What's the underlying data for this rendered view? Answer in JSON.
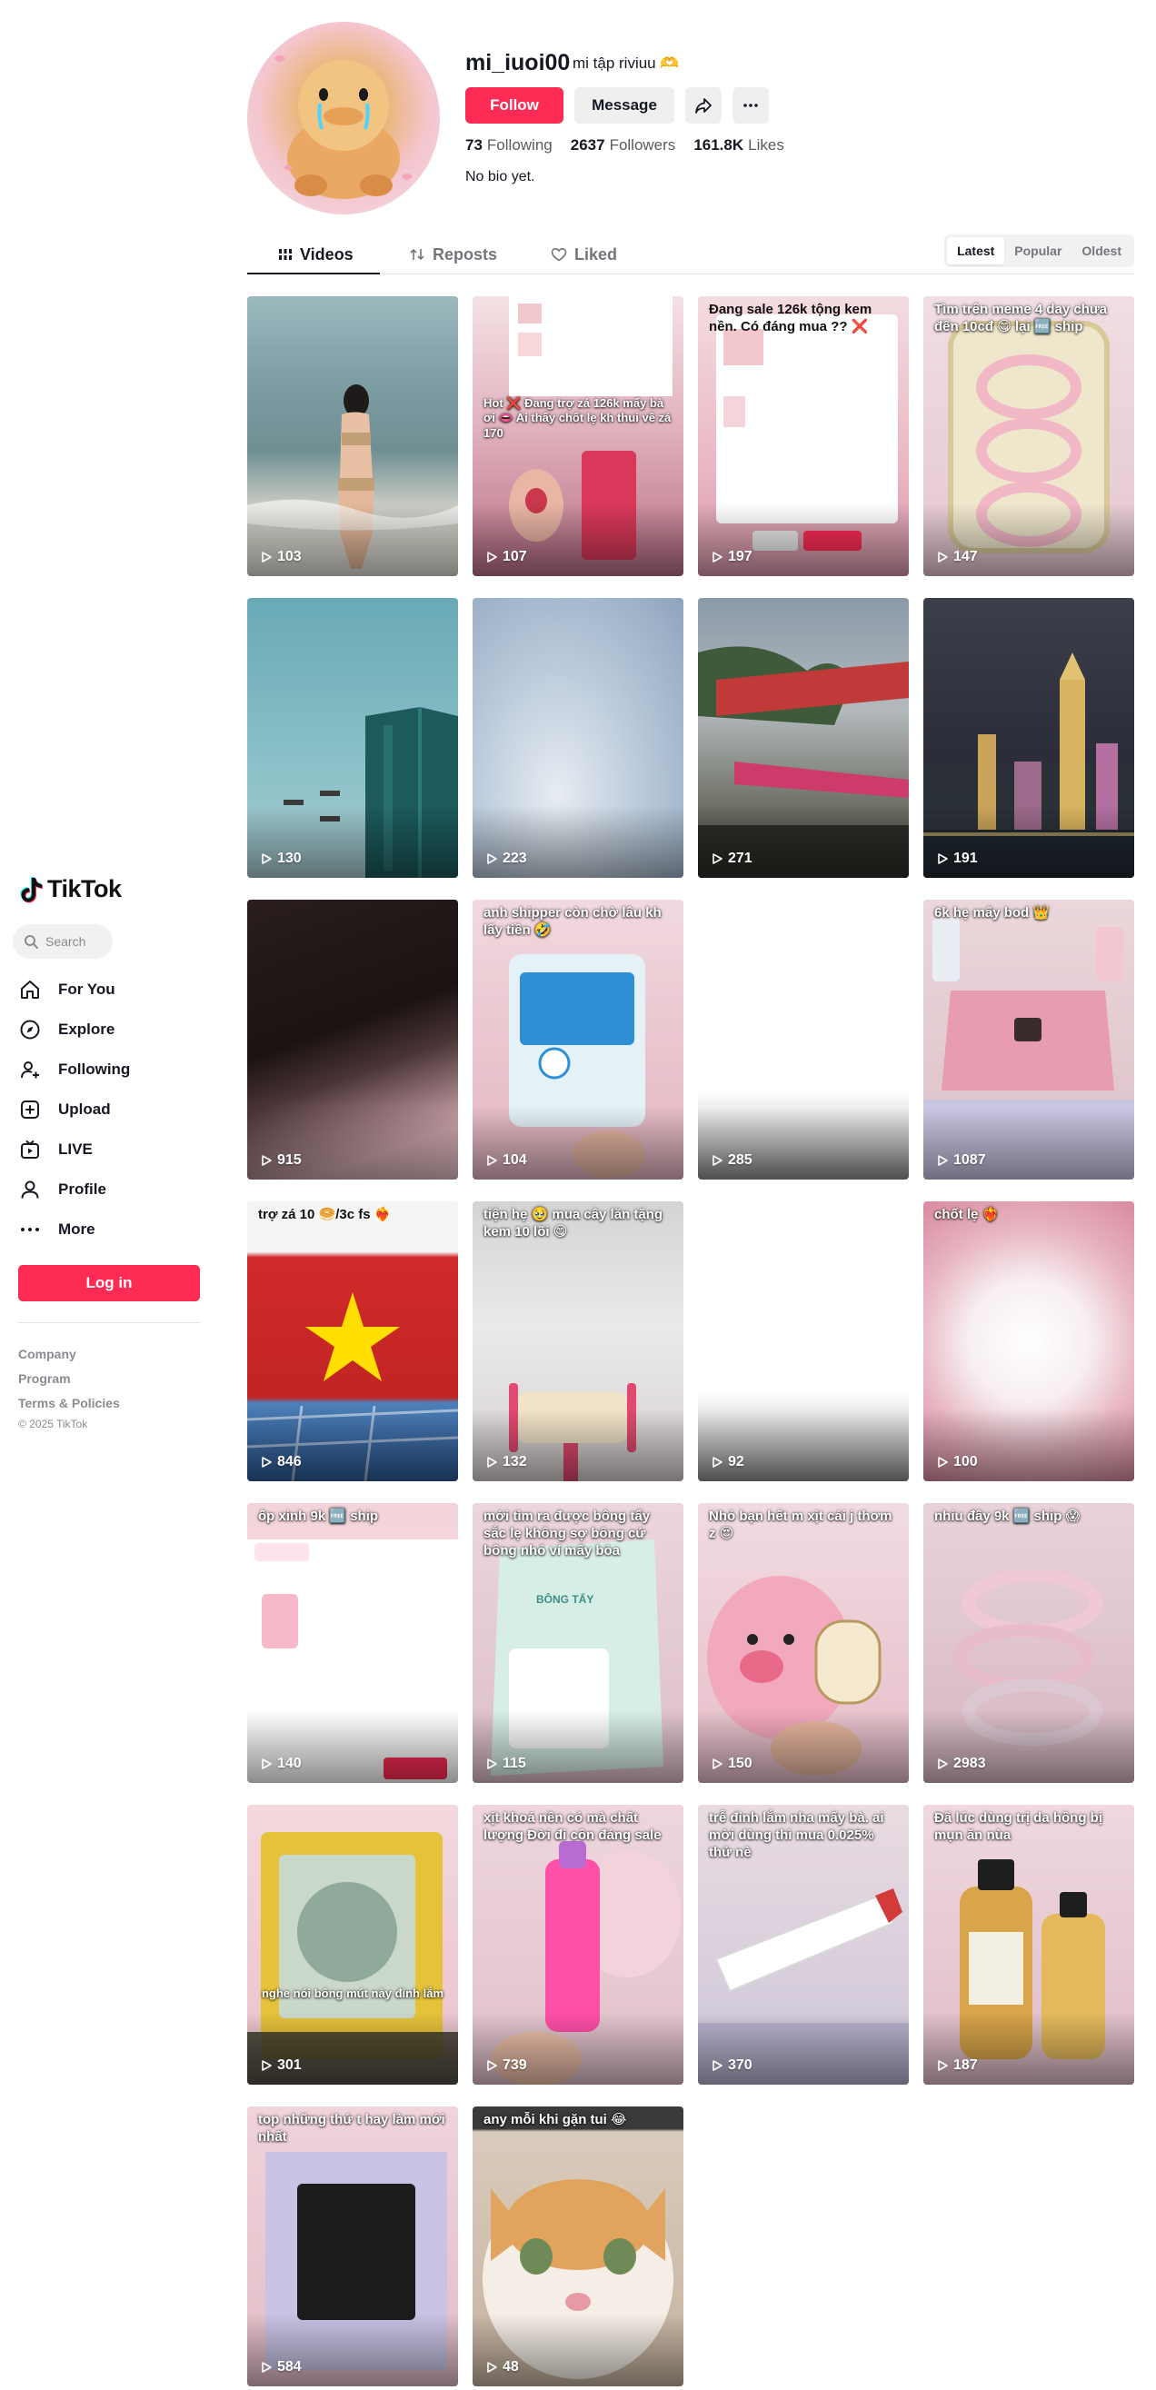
{
  "brand": {
    "name": "TikTok",
    "accent": "#fe2c55"
  },
  "sidebar": {
    "search_placeholder": "Search",
    "nav": [
      {
        "label": "For You",
        "icon": "home-icon"
      },
      {
        "label": "Explore",
        "icon": "compass-icon"
      },
      {
        "label": "Following",
        "icon": "following-icon"
      },
      {
        "label": "Upload",
        "icon": "upload-icon"
      },
      {
        "label": "LIVE",
        "icon": "live-icon"
      },
      {
        "label": "Profile",
        "icon": "profile-icon"
      },
      {
        "label": "More",
        "icon": "more-icon"
      }
    ],
    "login_label": "Log in",
    "footer": [
      "Company",
      "Program",
      "Terms & Policies"
    ],
    "copyright": "© 2025 TikTok"
  },
  "profile": {
    "username": "mi_iuoi00",
    "nickname": "mi tập riviuu 🫶",
    "follow_label": "Follow",
    "message_label": "Message",
    "stats": {
      "following_count": "73",
      "following_label": "Following",
      "followers_count": "2637",
      "followers_label": "Followers",
      "likes_count": "161.8K",
      "likes_label": "Likes"
    },
    "bio": "No bio yet."
  },
  "tabs": {
    "videos": "Videos",
    "reposts": "Reposts",
    "liked": "Liked"
  },
  "sort": {
    "latest": "Latest",
    "popular": "Popular",
    "oldest": "Oldest",
    "selected": "Latest"
  },
  "videos": [
    {
      "views": "103",
      "caption": ""
    },
    {
      "views": "107",
      "caption": "Hot ❌ Đang trợ zá 126k mấy bà ơi 👄 Ai thấy chốt lẹ kh thui về zá 170"
    },
    {
      "views": "197",
      "caption": "Đang sale 126k tộng kem nền. Có đáng mua ?? ❌"
    },
    {
      "views": "147",
      "caption": "Tìm trên meme 4 day chưa đến 10cđ 😋 lại 🆓 ship"
    },
    {
      "views": "130",
      "caption": ""
    },
    {
      "views": "223",
      "caption": ""
    },
    {
      "views": "271",
      "caption": ""
    },
    {
      "views": "191",
      "caption": ""
    },
    {
      "views": "915",
      "caption": ""
    },
    {
      "views": "104",
      "caption": "anh shipper còn chờ lâu kh lấy tiền 🤣"
    },
    {
      "views": "285",
      "caption": ""
    },
    {
      "views": "1087",
      "caption": "6k hẹ mấy bod 👑"
    },
    {
      "views": "846",
      "caption": "trợ zá 10 🥯/3c fs ❤️‍🔥"
    },
    {
      "views": "132",
      "caption": "tiện hẹ 🥹 mua cây lăn tặng kem 10 lõi 😋"
    },
    {
      "views": "92",
      "caption": ""
    },
    {
      "views": "100",
      "caption": "chốt lẹ ❤️‍🔥"
    },
    {
      "views": "140",
      "caption": "ốp xinh 9k 🆓 ship"
    },
    {
      "views": "115",
      "caption": "mới tìm ra được bông tẩy sắc lẹ không sợ bông cứ bông nhỏ ví mấy bòa"
    },
    {
      "views": "150",
      "caption": "Nhỏ bạn hết m xịt cái j thơm z 😍"
    },
    {
      "views": "2983",
      "caption": "nhiu đây 9k 🆓 ship 😱"
    },
    {
      "views": "301",
      "caption": "nghe nói bông mút này đỉnh lắm"
    },
    {
      "views": "739",
      "caption": "xịt khoá nền có mà chất lượng Đời đỉ côn đáng sale"
    },
    {
      "views": "370",
      "caption": "trễ đỉnh lắm nha mấy bà. ai mời dùng thì mua 0.025% thử nè"
    },
    {
      "views": "187",
      "caption": "Đã lúc dùng trị da hồng bị mụn ăn nùa"
    },
    {
      "views": "584",
      "caption": "top những thứ t hay làm mới nhất"
    },
    {
      "views": "48",
      "caption": "any mỗi khi gặn tui 😂"
    }
  ],
  "colors": {
    "text": "#161823",
    "muted": "#75767c",
    "button_gray": "#efeff0"
  }
}
